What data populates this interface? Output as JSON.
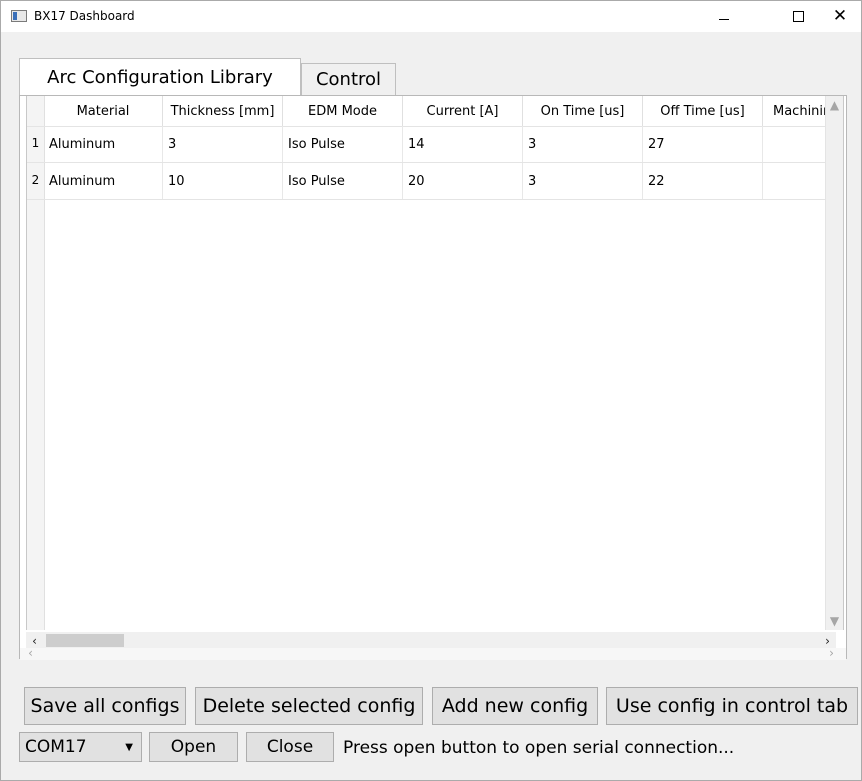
{
  "window": {
    "title": "BX17 Dashboard"
  },
  "tabs": [
    {
      "label": "Arc Configuration Library",
      "active": true
    },
    {
      "label": "Control",
      "active": false
    }
  ],
  "table": {
    "columns": [
      "Material",
      "Thickness [mm]",
      "EDM Mode",
      "Current [A]",
      "On Time [us]",
      "Off Time [us]",
      "Machining"
    ],
    "row_numbers": [
      "1",
      "2"
    ],
    "rows": [
      [
        "Aluminum",
        "3",
        "Iso Pulse",
        "14",
        "3",
        "27",
        ""
      ],
      [
        "Aluminum",
        "10",
        "Iso Pulse",
        "20",
        "3",
        "22",
        ""
      ]
    ]
  },
  "buttons": {
    "save_all": "Save all configs",
    "delete_selected": "Delete selected config",
    "add_new": "Add new config",
    "use_config": "Use config in control tab"
  },
  "status": {
    "port": "COM17",
    "open_label": "Open",
    "close_label": "Close",
    "message": "Press open button to open serial connection..."
  }
}
